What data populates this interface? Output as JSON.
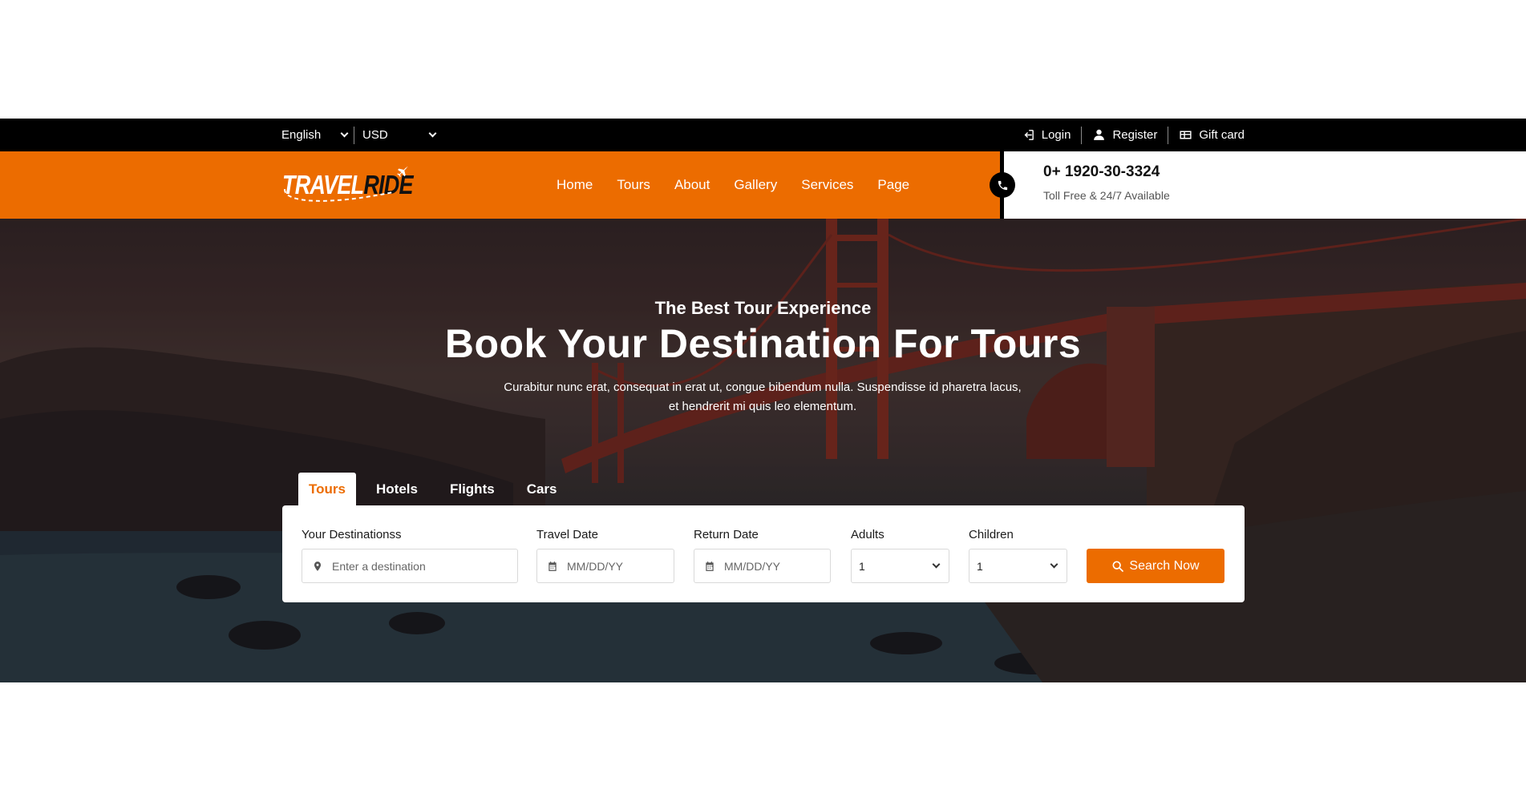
{
  "topbar": {
    "language": "English",
    "currency": "USD",
    "links": [
      {
        "label": "Login",
        "icon": "sign-in-icon"
      },
      {
        "label": "Register",
        "icon": "user-icon"
      },
      {
        "label": "Gift card",
        "icon": "gift-card-icon"
      }
    ]
  },
  "header": {
    "logo": {
      "part1": "TRAVEL",
      "part2": "RIDE"
    },
    "nav": [
      "Home",
      "Tours",
      "About",
      "Gallery",
      "Services",
      "Page"
    ],
    "phone": {
      "number": "0+ 1920-30-3324",
      "subtitle": "Toll Free & 24/7 Available",
      "icon": "phone-icon"
    }
  },
  "hero": {
    "subtitle": "The Best Tour Experience",
    "title": "Book Your Destination For Tours",
    "description_line1": "Curabitur nunc erat, consequat in erat ut, congue bibendum nulla. Suspendisse id pharetra lacus,",
    "description_line2": "et hendrerit mi quis leo elementum."
  },
  "booking": {
    "tabs": [
      "Tours",
      "Hotels",
      "Flights",
      "Cars"
    ],
    "active_tab": "Tours",
    "fields": {
      "destination": {
        "label": "Your Destinationss",
        "placeholder": "Enter a destination"
      },
      "travel_date": {
        "label": "Travel Date",
        "placeholder": "MM/DD/YY"
      },
      "return_date": {
        "label": "Return Date",
        "placeholder": "MM/DD/YY"
      },
      "adults": {
        "label": "Adults",
        "value": "1"
      },
      "children": {
        "label": "Children",
        "value": "1"
      }
    },
    "search_label": "Search Now"
  },
  "colors": {
    "brand_orange": "#ec6c00",
    "topbar_black": "#000000"
  }
}
